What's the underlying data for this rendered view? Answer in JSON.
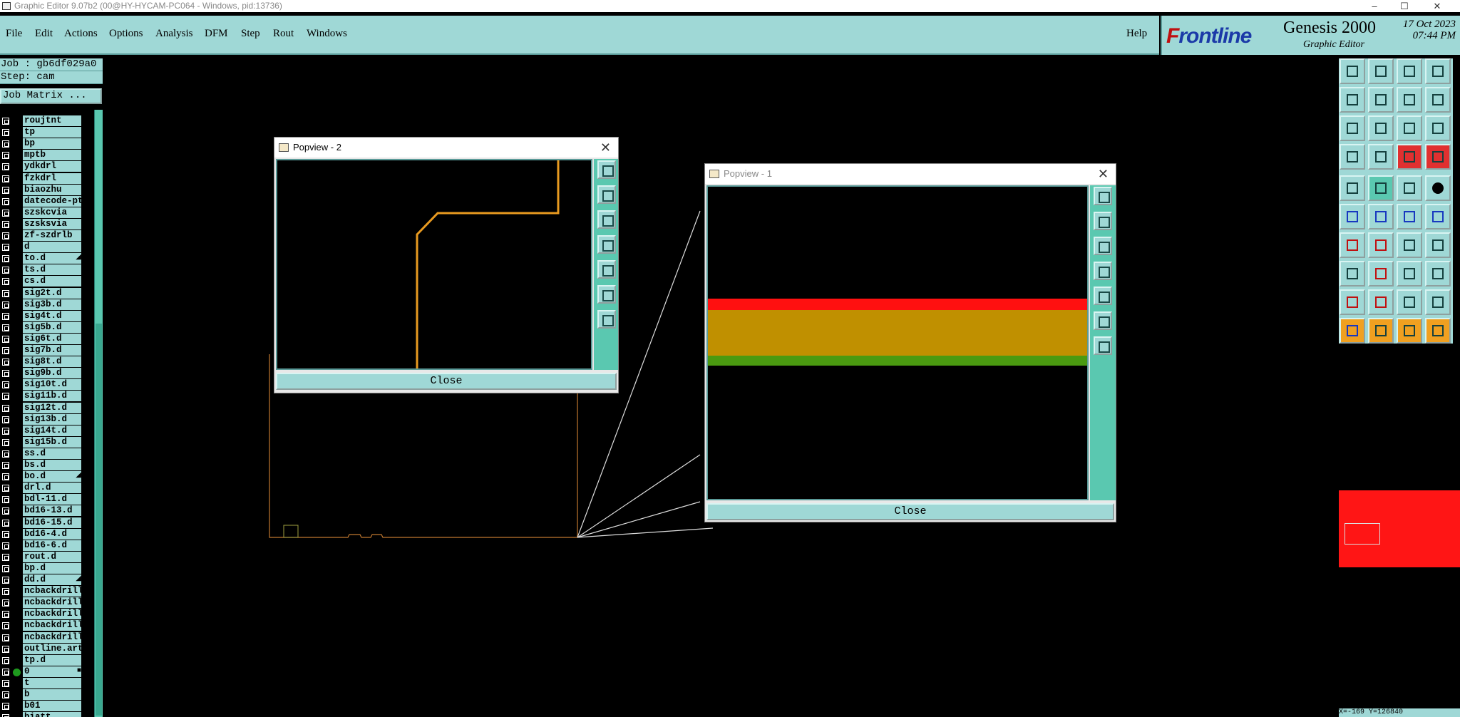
{
  "window": {
    "title": "Graphic Editor 9.07b2 (00@HY-HYCAM-PC064 - Windows, pid:13736)",
    "controls": [
      "–",
      "☐",
      "✕"
    ]
  },
  "menu": {
    "items": [
      "File",
      "Edit",
      "Actions",
      "Options",
      "Analysis",
      "DFM",
      "Step",
      "Rout",
      "Windows"
    ],
    "help": "Help"
  },
  "brand": {
    "logo": "Frontline",
    "product": "Genesis 2000",
    "subtitle": "Graphic Editor",
    "date": "17 Oct 2023",
    "time": "07:44 PM"
  },
  "job": {
    "job_line": "Job : gb6df029a0",
    "step_line": "Step: cam",
    "matrix_button": "Job Matrix ..."
  },
  "layers": [
    {
      "name": "roujtnt"
    },
    {
      "name": "tp"
    },
    {
      "name": "bp"
    },
    {
      "name": "mptb"
    },
    {
      "name": "ydkdrl"
    },
    {
      "name": "fzkdrl"
    },
    {
      "name": "biaozhu"
    },
    {
      "name": "datecode-pt"
    },
    {
      "name": "szskcvia"
    },
    {
      "name": "szsksvia"
    },
    {
      "name": "zf-szdrlb"
    },
    {
      "name": "d"
    },
    {
      "name": "to.d",
      "mark": "◢"
    },
    {
      "name": "ts.d"
    },
    {
      "name": "cs.d"
    },
    {
      "name": "sig2t.d"
    },
    {
      "name": "sig3b.d"
    },
    {
      "name": "sig4t.d"
    },
    {
      "name": "sig5b.d"
    },
    {
      "name": "sig6t.d"
    },
    {
      "name": "sig7b.d"
    },
    {
      "name": "sig8t.d"
    },
    {
      "name": "sig9b.d"
    },
    {
      "name": "sig10t.d"
    },
    {
      "name": "sig11b.d"
    },
    {
      "name": "sig12t.d"
    },
    {
      "name": "sig13b.d"
    },
    {
      "name": "sig14t.d"
    },
    {
      "name": "sig15b.d"
    },
    {
      "name": "ss.d"
    },
    {
      "name": "bs.d"
    },
    {
      "name": "bo.d",
      "mark": "◢"
    },
    {
      "name": "drl.d"
    },
    {
      "name": "bdl-11.d"
    },
    {
      "name": "bd16-13.d"
    },
    {
      "name": "bd16-15.d"
    },
    {
      "name": "bd16-4.d"
    },
    {
      "name": "bd16-6.d"
    },
    {
      "name": "rout.d"
    },
    {
      "name": "bp.d"
    },
    {
      "name": "dd.d",
      "mark": "◢"
    },
    {
      "name": "ncbackdrill"
    },
    {
      "name": "ncbackdrill"
    },
    {
      "name": "ncbackdrill"
    },
    {
      "name": "ncbackdrill"
    },
    {
      "name": "ncbackdrill"
    },
    {
      "name": "outline.art"
    },
    {
      "name": "tp.d"
    },
    {
      "name": "0",
      "active": true,
      "mark": "■"
    },
    {
      "name": "t"
    },
    {
      "name": "b"
    },
    {
      "name": "b01"
    },
    {
      "name": "biatt"
    }
  ],
  "popview2": {
    "title": "Popview - 2",
    "close": "Close"
  },
  "popview1": {
    "title": "Popview - 1",
    "close": "Close"
  },
  "colors": {
    "panel": "#9fd8d6",
    "side": "#5ac8b0",
    "trace": "#e89a20",
    "red_band": "#ff1010",
    "gold_band": "#c09000",
    "green_band": "#4a9a10"
  },
  "statusbar": {
    "text": "X=-169 Y=126840"
  }
}
